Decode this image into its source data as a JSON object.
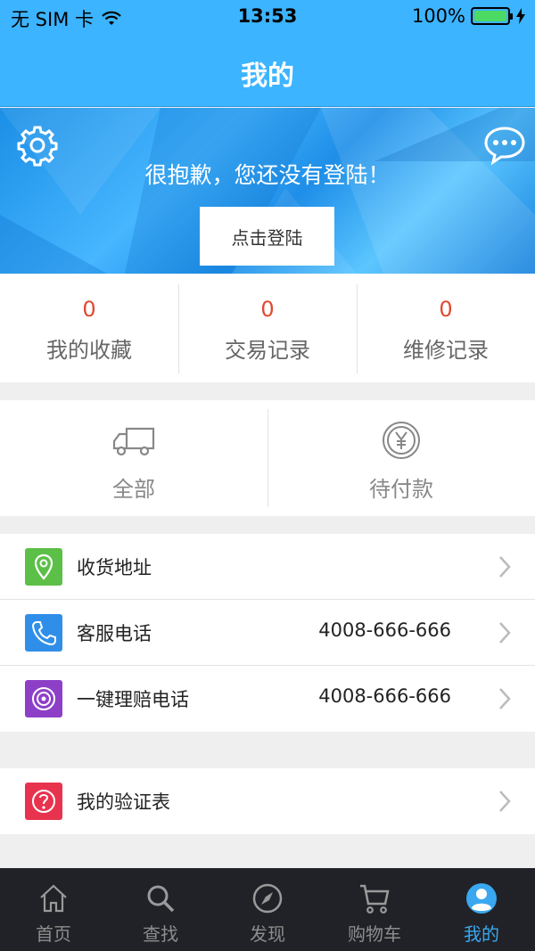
{
  "status": {
    "carrier": "无 SIM 卡",
    "time": "13:53",
    "battery": "100%",
    "battery_level": 1.0
  },
  "header": {
    "title": "我的"
  },
  "banner": {
    "message": "很抱歉，您还没有登陆！",
    "login_label": "点击登陆",
    "icons": [
      "gear-icon",
      "chat-bubble-icon"
    ]
  },
  "stats": [
    {
      "count": "0",
      "label": "我的收藏"
    },
    {
      "count": "0",
      "label": "交易记录"
    },
    {
      "count": "0",
      "label": "维修记录"
    }
  ],
  "orders": [
    {
      "label": "全部",
      "icon": "truck-icon"
    },
    {
      "label": "待付款",
      "icon": "yen-coin-icon"
    }
  ],
  "menu": [
    {
      "label": "收货地址",
      "value": "",
      "icon": "location-pin-icon",
      "color": "#5cbf47"
    },
    {
      "label": "客服电话",
      "value": "4008-666-666",
      "icon": "phone-icon",
      "color": "#2f8fe8"
    },
    {
      "label": "一键理赔电话",
      "value": "4008-666-666",
      "icon": "target-icon",
      "color": "#8e3fc7"
    }
  ],
  "menu2": [
    {
      "label": "我的验证表",
      "value": "",
      "icon": "question-icon",
      "color": "#e8334f"
    }
  ],
  "tabs": [
    {
      "label": "首页",
      "icon": "home-icon",
      "active": false
    },
    {
      "label": "查找",
      "icon": "search-icon",
      "active": false
    },
    {
      "label": "发现",
      "icon": "compass-icon",
      "active": false
    },
    {
      "label": "购物车",
      "icon": "cart-icon",
      "active": false
    },
    {
      "label": "我的",
      "icon": "user-icon",
      "active": true
    }
  ],
  "colors": {
    "brand": "#3cb4ff",
    "count": "#e0492f",
    "tab_active": "#3aa8f0",
    "tabbar": "#202227"
  }
}
